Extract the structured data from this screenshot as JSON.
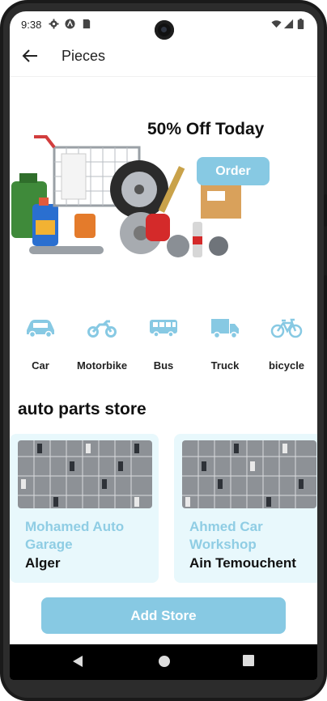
{
  "status_bar": {
    "time": "9:38"
  },
  "app_bar": {
    "title": "Pieces"
  },
  "hero": {
    "headline": "50% Off Today",
    "cta_label": "Order"
  },
  "categories": [
    {
      "label": "Car",
      "icon": "car-icon"
    },
    {
      "label": "Motorbike",
      "icon": "motorbike-icon"
    },
    {
      "label": "Bus",
      "icon": "bus-icon"
    },
    {
      "label": "Truck",
      "icon": "truck-icon"
    },
    {
      "label": "bicycle",
      "icon": "bicycle-icon"
    }
  ],
  "stores_section": {
    "title": "auto parts store",
    "stores": [
      {
        "name": "Mohamed Auto Garage",
        "city": "Alger"
      },
      {
        "name": "Ahmed Car Workshop",
        "city": "Ain Temouchent"
      }
    ]
  },
  "add_store_label": "Add Store",
  "colors": {
    "accent": "#87c9e3",
    "card_bg": "#e8f8fc",
    "store_name": "#8fcde4"
  }
}
